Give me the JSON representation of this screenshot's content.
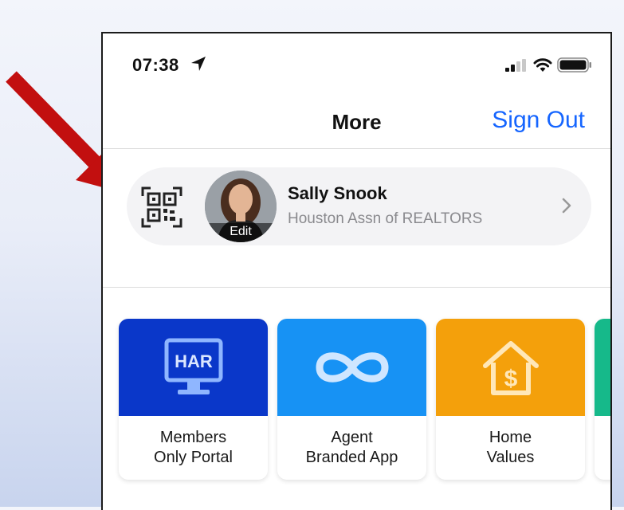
{
  "statusbar": {
    "time": "07:38"
  },
  "navbar": {
    "title": "More",
    "sign_out": "Sign Out"
  },
  "profile": {
    "name": "Sally Snook",
    "organization": "Houston Assn of REALTORS",
    "edit_label": "Edit"
  },
  "tiles": [
    {
      "label": "Members\nOnly Portal",
      "icon_text": "HAR",
      "color": "#0a37c9",
      "icon": "monitor-icon"
    },
    {
      "label": "Agent\nBranded App",
      "color": "#1792f4",
      "icon": "infinity-icon"
    },
    {
      "label": "Home\nValues",
      "color": "#f4a00b",
      "icon": "house-dollar-icon"
    },
    {
      "label": "",
      "color": "#16b98a",
      "icon": ""
    }
  ],
  "colors": {
    "accent": "#1565ff",
    "arrow": "#c20f0f"
  }
}
